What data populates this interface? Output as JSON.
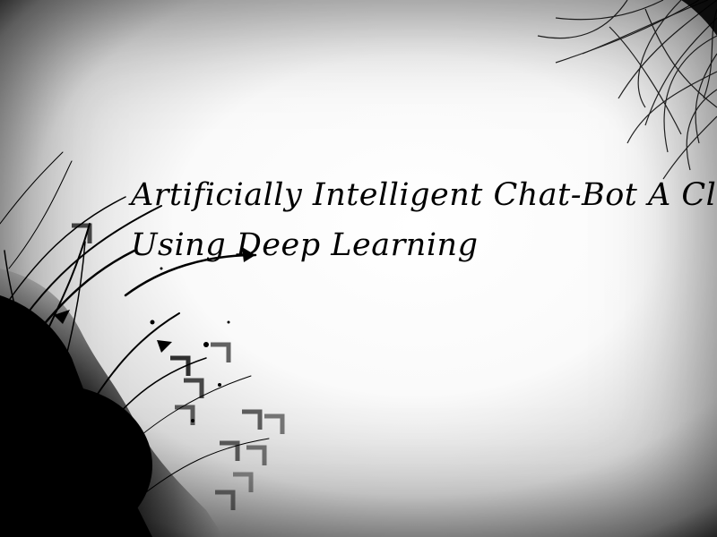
{
  "slide": {
    "title_line1": "Artificially Intelligent Chat-Bot A Clone",
    "title_line2": "Using Deep Learning"
  },
  "colors": {
    "ink": "#000000",
    "background": "#ffffff"
  },
  "icons": {
    "decor_left": "ink-splash-arrows-decoration",
    "decor_top_right": "tangled-lines-decoration"
  }
}
